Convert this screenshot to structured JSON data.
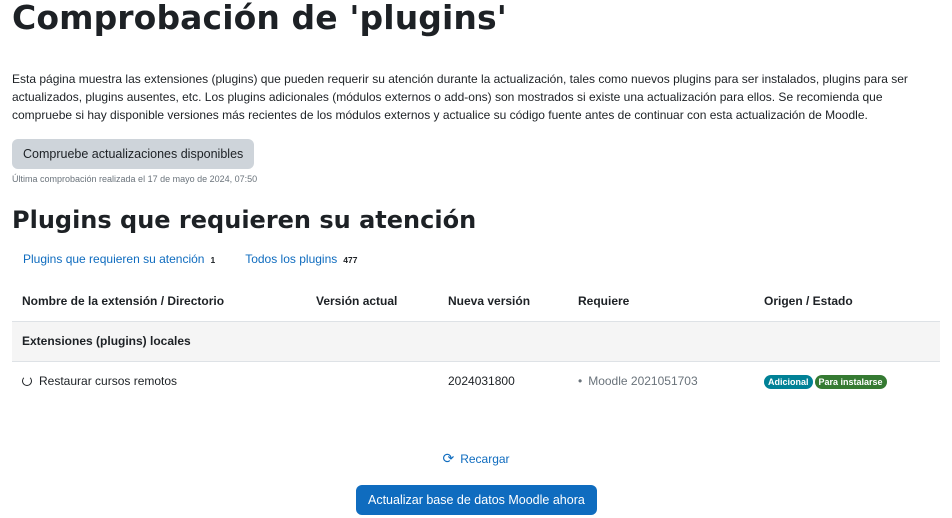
{
  "page": {
    "title": "Comprobación de 'plugins'",
    "intro": "Esta página muestra las extensiones (plugins) que pueden requerir su atención durante la actualización, tales como nuevos plugins para ser instalados, plugins para ser actualizados, plugins ausentes, etc. Los plugins adicionales (módulos externos o add-ons) son mostrados si existe una actualización para ellos. Se recomienda que compruebe si hay disponible versiones más recientes de los módulos externos y actualice su código fuente antes de continuar con esta actualización de Moodle.",
    "check_button": "Compruebe actualizaciones disponibles",
    "last_check": "Última comprobación realizada el 17 de mayo de 2024, 07:50"
  },
  "section": {
    "title": "Plugins que requieren su atención",
    "filters": [
      {
        "label": "Plugins que requieren su atención",
        "count": "1"
      },
      {
        "label": "Todos los plugins",
        "count": "477"
      }
    ]
  },
  "table": {
    "headers": [
      "Nombre de la extensión / Directorio",
      "Versión actual",
      "Nueva versión",
      "Requiere",
      "Origen / Estado"
    ],
    "group": "Extensiones (plugins) locales",
    "row": {
      "name": "Restaurar cursos remotos",
      "current_version": "",
      "new_version": "2024031800",
      "requires": "Moodle 2021051703",
      "badges": [
        "Adicional",
        "Para instalarse"
      ]
    }
  },
  "actions": {
    "reload": "Recargar",
    "upgrade": "Actualizar base de datos Moodle ahora"
  },
  "colors": {
    "link": "#0f6cbf",
    "badge_info": "#008196",
    "badge_success": "#357a32"
  }
}
